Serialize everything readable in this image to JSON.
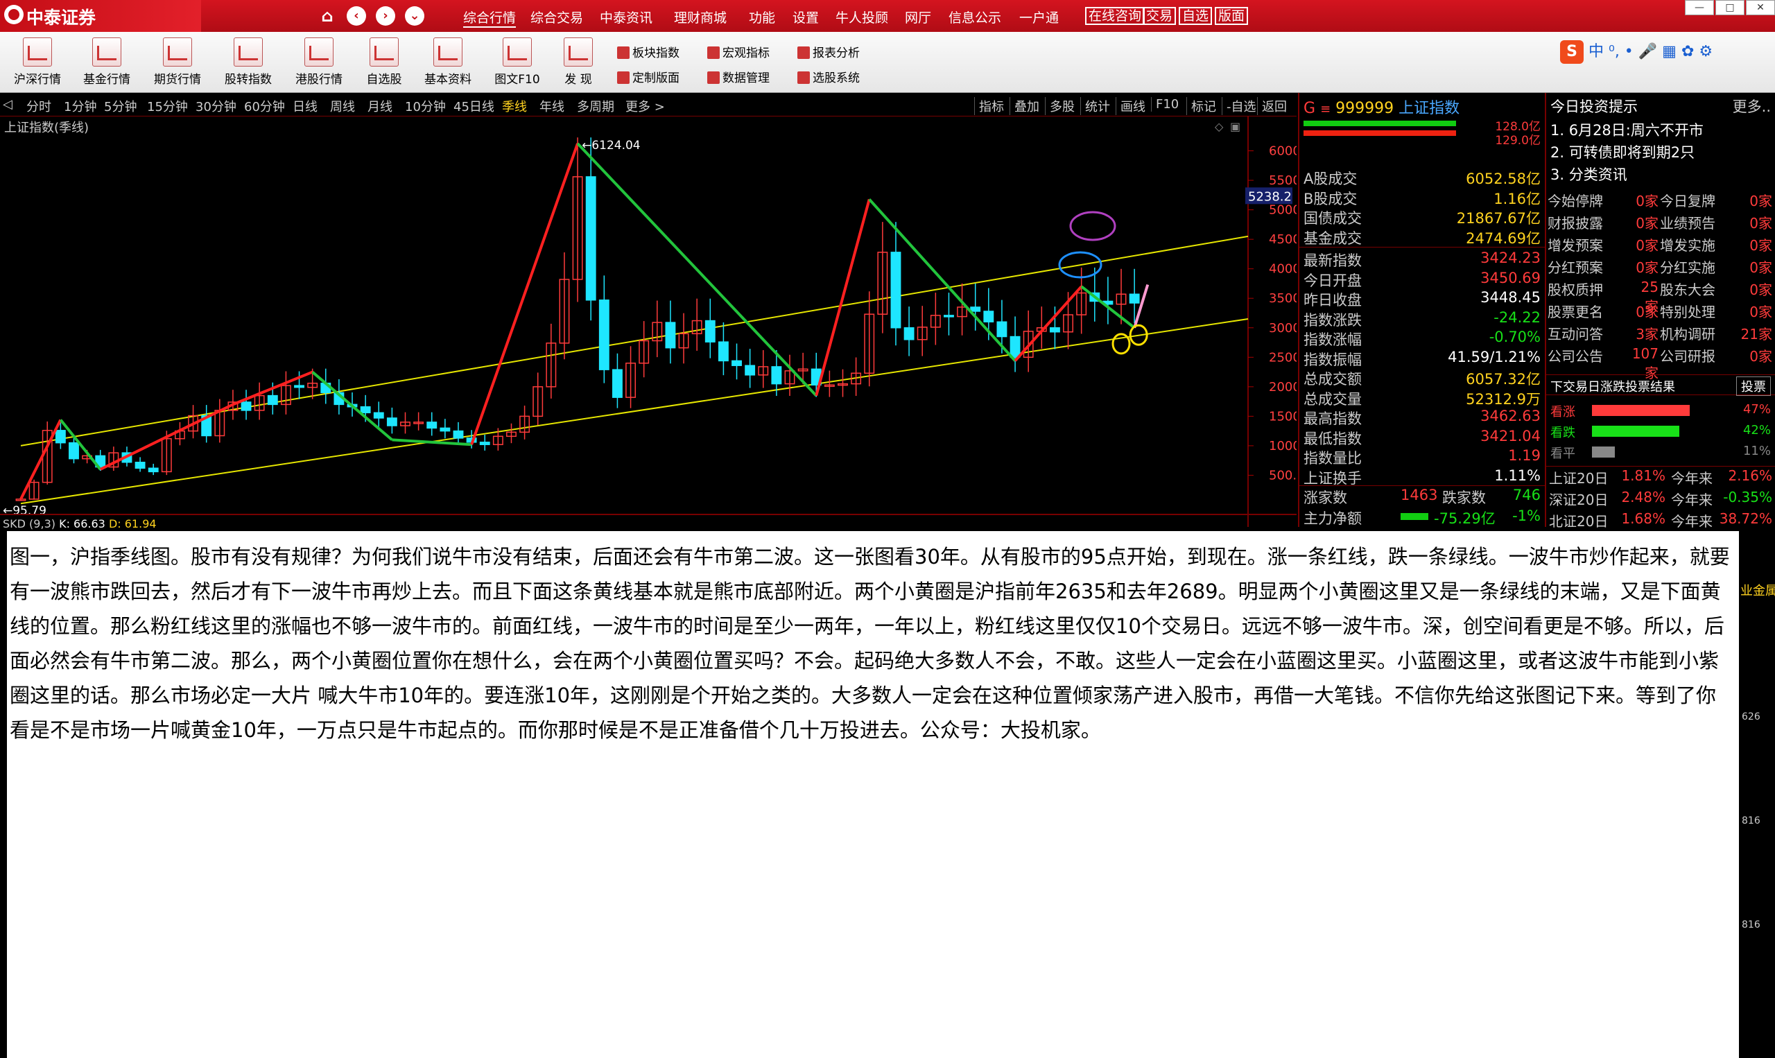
{
  "app": {
    "title": "中泰证券"
  },
  "menu": [
    "综合行情",
    "综合交易",
    "中泰资讯",
    "理财商城",
    "功能",
    "设置",
    "牛人投顾",
    "网厅",
    "信息公示",
    "一户通"
  ],
  "titlebox": [
    "在线咨询",
    "交易",
    "自选",
    "版面"
  ],
  "toolbar": [
    "沪深行情",
    "基金行情",
    "期货行情",
    "股转指数",
    "港股行情",
    "自选股",
    "基本资料",
    "图文F10",
    "发  现"
  ],
  "toolbar_small": [
    "板块指数",
    "定制版面",
    "宏观指标",
    "数据管理",
    "报表分析",
    "选股系统"
  ],
  "ime": {
    "lang": "中 ⁰,"
  },
  "periods": [
    "分时",
    "1分钟",
    "5分钟",
    "15分钟",
    "30分钟",
    "60分钟",
    "日线",
    "周线",
    "月线",
    "10分钟",
    "45日线",
    "季线",
    "年线",
    "多周期",
    "更多 >"
  ],
  "active_period": "季线",
  "chart_tools": [
    "指标",
    "叠加",
    "多股",
    "统计",
    "画线",
    "F10",
    "标记",
    "-自选",
    "返回"
  ],
  "chart_data": {
    "type": "candlestick",
    "title": "上证指数(季线)",
    "high_label": "6124.04",
    "low_label": "95.79",
    "current_label": "5238.2",
    "y_ticks": [
      "6000",
      "5500",
      "5000",
      "4500",
      "4000",
      "3500",
      "3000",
      "2500",
      "2000",
      "1500",
      "1000",
      "500.0"
    ],
    "ylim": [
      0,
      6300
    ],
    "indicator": {
      "name": "SKD (9,3)",
      "k": "K: 66.63",
      "d": "D: 61.94"
    },
    "colors": {
      "up": "#ff3b3b",
      "down": "#1ee6ff",
      "channel": "#e6e600",
      "bull": "#ff2020",
      "bear": "#22c43c",
      "pink": "#ff9ad0"
    },
    "quarterly_close": [
      95,
      380,
      1260,
      1050,
      780,
      830,
      640,
      880,
      720,
      620,
      560,
      1120,
      1250,
      1510,
      1170,
      1600,
      1740,
      1600,
      1850,
      1700,
      2020,
      1990,
      2060,
      1900,
      1700,
      1660,
      1560,
      1470,
      1340,
      1400,
      1400,
      1300,
      1250,
      1130,
      1060,
      1020,
      1160,
      1230,
      1500,
      2000,
      2740,
      3820,
      5560,
      3470,
      2290,
      1820,
      2400,
      2780,
      3090,
      2660,
      2900,
      3120,
      2760,
      2440,
      2360,
      2200,
      2340,
      2050,
      2270,
      2300,
      2030,
      2030,
      2050,
      2230,
      3230,
      4280,
      3000,
      2800,
      3010,
      3210,
      3190,
      3350,
      3280,
      3100,
      2850,
      2500,
      2940,
      3000,
      2930,
      3220,
      3590,
      3450,
      3400,
      3570,
      3420
    ],
    "bull_segments": [
      [
        0,
        95
      ],
      [
        3,
        1440
      ],
      [
        6,
        600
      ],
      [
        16,
        1700
      ],
      [
        22,
        2250
      ],
      [
        28,
        1100
      ],
      [
        34,
        1020
      ],
      [
        42,
        6124
      ],
      [
        60,
        1850
      ],
      [
        64,
        5178
      ],
      [
        75,
        2440
      ],
      [
        80,
        3700
      ],
      [
        84,
        3000
      ],
      [
        85,
        3731
      ]
    ],
    "annotations": [
      "2635",
      "2689"
    ]
  },
  "quote": {
    "flag": "G",
    "code": "999999",
    "name": "上证指数",
    "bar_top": "128.0亿",
    "bar_bottom": "129.0亿",
    "rows": [
      {
        "k": "A股成交",
        "v": "6052.58亿",
        "c": "yel"
      },
      {
        "k": "B股成交",
        "v": "1.16亿",
        "c": "yel"
      },
      {
        "k": "国债成交",
        "v": "21867.67亿",
        "c": "yel"
      },
      {
        "k": "基金成交",
        "v": "2474.69亿",
        "c": "yel"
      },
      {
        "k": "最新指数",
        "v": "3424.23",
        "c": "red"
      },
      {
        "k": "今日开盘",
        "v": "3450.69",
        "c": "red"
      },
      {
        "k": "昨日收盘",
        "v": "3448.45",
        "c": "wht"
      },
      {
        "k": "指数涨跌",
        "v": "-24.22",
        "c": "grn"
      },
      {
        "k": "指数涨幅",
        "v": "-0.70%",
        "c": "grn"
      },
      {
        "k": "指数振幅",
        "v": "41.59/1.21%",
        "c": "wht"
      },
      {
        "k": "总成交额",
        "v": "6057.32亿",
        "c": "yel"
      },
      {
        "k": "总成交量",
        "v": "52312.9万",
        "c": "yel"
      },
      {
        "k": "最高指数",
        "v": "3462.63",
        "c": "red"
      },
      {
        "k": "最低指数",
        "v": "3421.04",
        "c": "red"
      },
      {
        "k": "指数量比",
        "v": "1.19",
        "c": "red"
      },
      {
        "k": "上证换手",
        "v": "1.11%",
        "c": "wht"
      }
    ],
    "up_label": "涨家数",
    "up_count": "1463",
    "down_label": "跌家数",
    "down_count": "746",
    "flow_label": "主力净额",
    "flow_value": "-75.29亿",
    "flow_pct": "-1%"
  },
  "tips": {
    "title": "今日投资提示",
    "more": "更多..",
    "items": [
      "1. 6月28日:周六不开市",
      "2. 可转债即将到期2只",
      "3. 分类资讯"
    ],
    "counts": [
      [
        "今始停牌",
        "0家",
        "今日复牌",
        "0家"
      ],
      [
        "财报披露",
        "0家",
        "业绩预告",
        "0家"
      ],
      [
        "增发预案",
        "0家",
        "增发实施",
        "0家"
      ],
      [
        "分红预案",
        "0家",
        "分红实施",
        "0家"
      ],
      [
        "股权质押",
        "25家",
        "股东大会",
        "0家"
      ],
      [
        "股票更名",
        "0家",
        "特别处理",
        "0家"
      ],
      [
        "互动问答",
        "3家",
        "机构调研",
        "21家"
      ],
      [
        "公司公告",
        "107家",
        "公司研报",
        "0家"
      ]
    ]
  },
  "vote": {
    "title": "下交易日涨跌投票结果",
    "button": "投票",
    "rows": [
      {
        "label": "看涨",
        "pct": "47%",
        "frac": 0.47,
        "color": "#ff3b3b"
      },
      {
        "label": "看跌",
        "pct": "42%",
        "frac": 0.42,
        "color": "#18e018"
      },
      {
        "label": "看平",
        "pct": "11%",
        "frac": 0.11,
        "color": "#888888"
      }
    ]
  },
  "index_perf": [
    [
      "上证20日",
      "1.81%",
      "今年来",
      "2.16%"
    ],
    [
      "深证20日",
      "2.48%",
      "今年来",
      "-0.35%"
    ],
    [
      "北证20日",
      "1.68%",
      "今年来",
      "38.72%"
    ]
  ],
  "note": {
    "text": "图一，沪指季线图。股市有没有规律？为何我们说牛市没有结束，后面还会有牛市第二波。这一张图看30年。从有股市的95点开始，到现在。涨一条红线，跌一条绿线。一波牛市炒作起来，就要有一波熊市跌回去，然后才有下一波牛市再炒上去。而且下面这条黄线基本就是熊市底部附近。两个小黄圈是沪指前年2635和去年2689。明显两个小黄圈这里又是一条绿线的末端，又是下面黄线的位置。那么粉红线这里的涨幅也不够一波牛市的。前面红线，一波牛市的时间是至少一两年，一年以上，粉红线这里仅仅10个交易日。远远不够一波牛市。深，创空间看更是不够。所以，后面必然会有牛市第二波。那么，两个小黄圈位置你在想什么，会在两个小黄圈位置买吗？不会。起码绝大多数人不会，不敢。这些人一定会在小蓝圈这里买。小蓝圈这里，或者这波牛市能到小紫圈这里的话。那么市场必定一大片 喊大牛市10年的。要连涨10年，这刚刚是个开始之类的。大多数人一定会在这种位置倾家荡产进入股市，再借一大笔钱。不信你先给这张图记下来。等到了你看是不是市场一片喊黄金10年，一万点只是牛市起点的。而你那时候是不是正准备借个几十万投进去。公众号：大投机家。"
  },
  "side": {
    "label": "业金属",
    "v1": "626",
    "v2": "816",
    "v3": "816"
  }
}
